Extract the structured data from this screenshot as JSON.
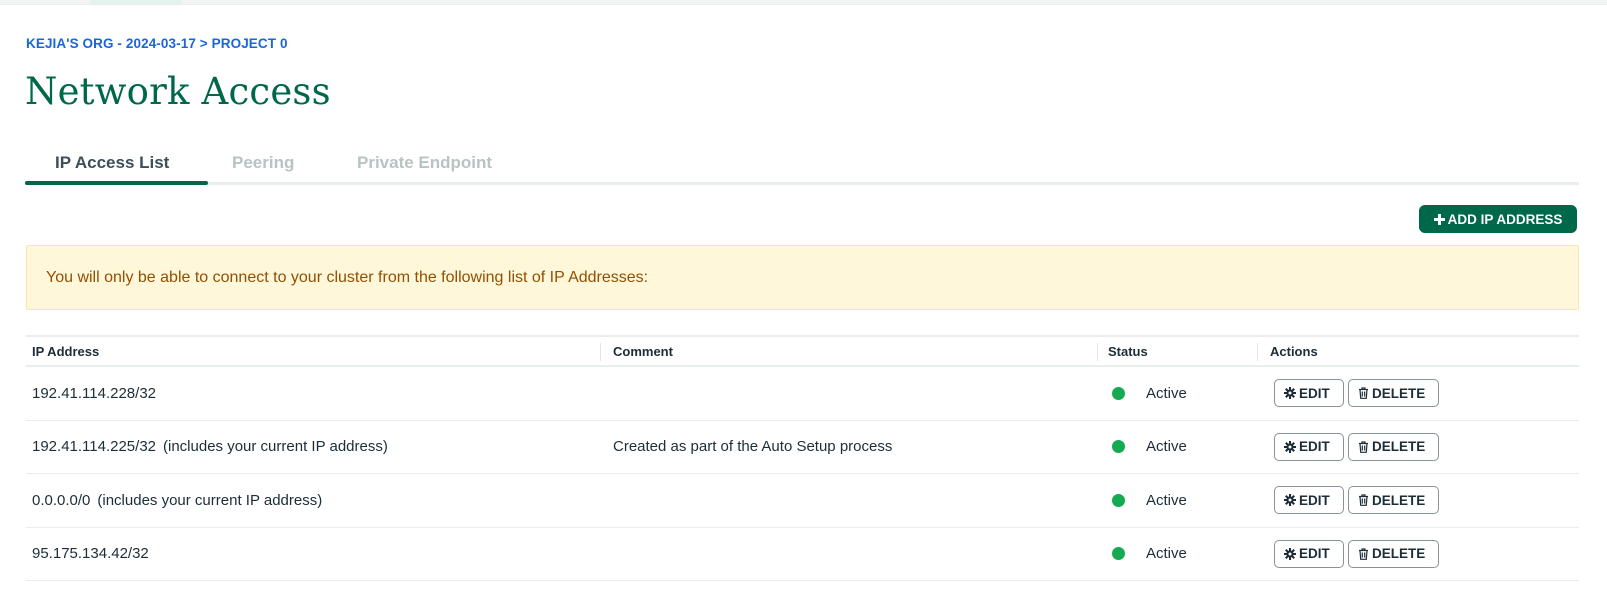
{
  "breadcrumb": {
    "org": "KEJIA'S ORG - 2024-03-17",
    "separator": ">",
    "project": "PROJECT 0"
  },
  "page_title": "Network Access",
  "tabs": [
    {
      "label": "IP Access List",
      "active": true
    },
    {
      "label": "Peering",
      "active": false
    },
    {
      "label": "Private Endpoint",
      "active": false
    }
  ],
  "add_button": {
    "icon": "plus-icon",
    "label": "ADD IP ADDRESS"
  },
  "banner": {
    "text": "You will only be able to connect to your cluster from the following list of IP Addresses:"
  },
  "table": {
    "headers": {
      "ip": "IP Address",
      "comment": "Comment",
      "status": "Status",
      "actions": "Actions"
    },
    "rows": [
      {
        "ip": "192.41.114.228/32",
        "note": "",
        "comment": "",
        "status": "Active"
      },
      {
        "ip": "192.41.114.225/32",
        "note": "(includes your current IP address)",
        "comment": "Created as part of the Auto Setup process",
        "status": "Active"
      },
      {
        "ip": "0.0.0.0/0",
        "note": "(includes your current IP address)",
        "comment": "",
        "status": "Active"
      },
      {
        "ip": "95.175.134.42/32",
        "note": "",
        "comment": "",
        "status": "Active"
      }
    ],
    "edit_label": "EDIT",
    "delete_label": "DELETE",
    "edit_icon": "gear-icon",
    "delete_icon": "trash-icon"
  },
  "colors": {
    "brand": "#00684a",
    "link": "#1a66d6",
    "status_active": "#13aa52",
    "banner_bg": "#fef7da",
    "banner_text": "#944f01"
  }
}
